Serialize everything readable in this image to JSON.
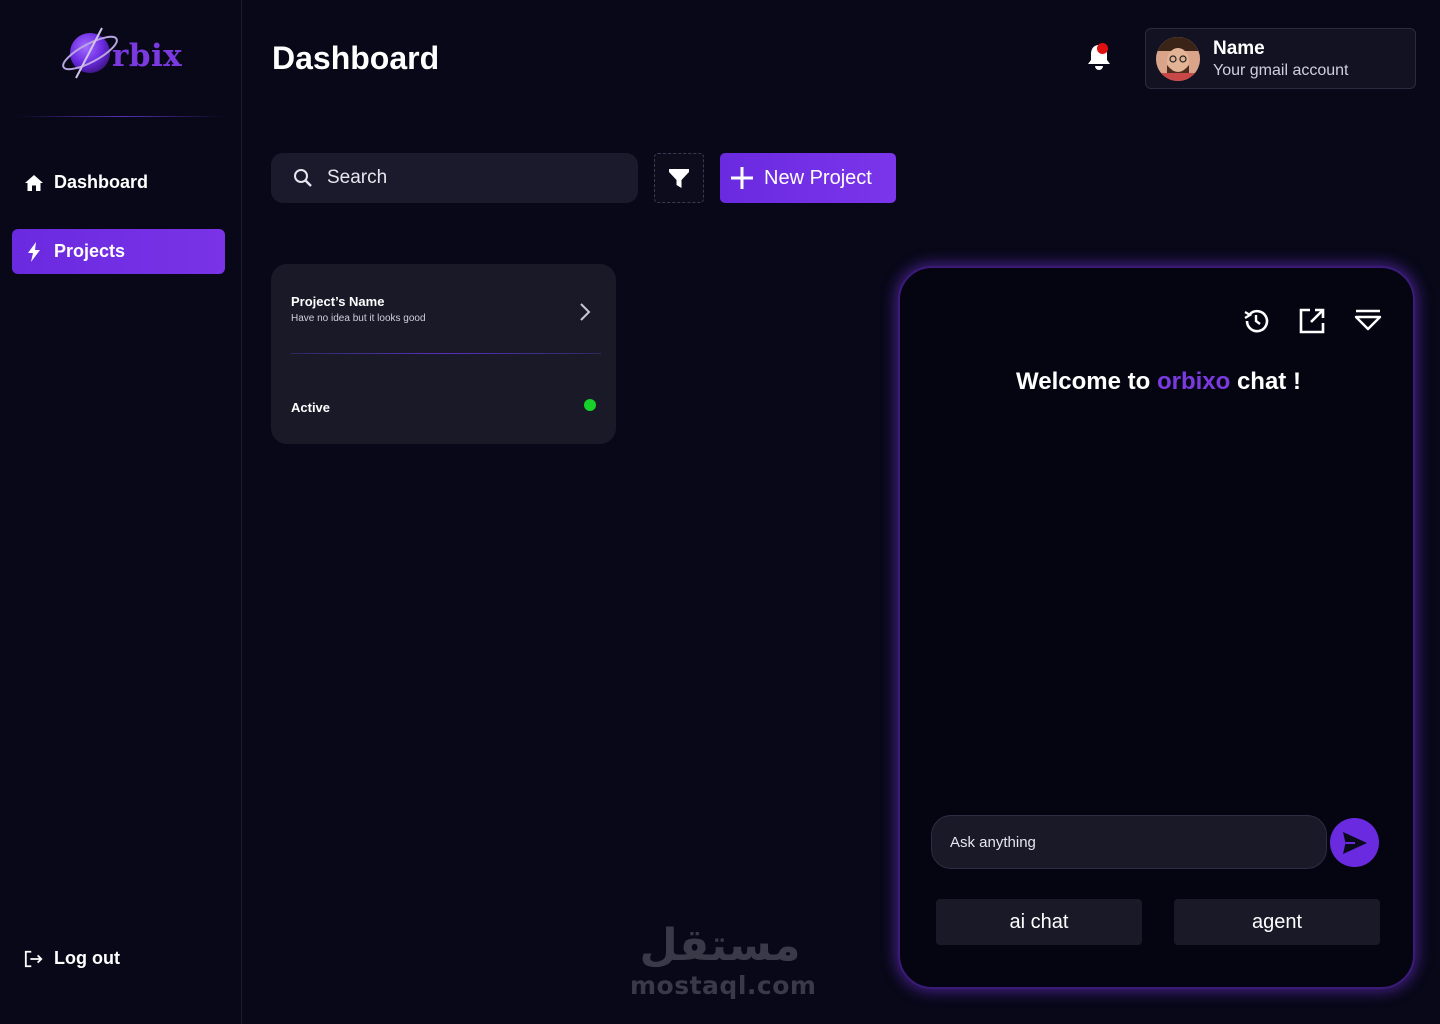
{
  "brand": {
    "logo_text": "rbix",
    "accent_color": "#6a2ae0"
  },
  "sidebar": {
    "items": [
      {
        "label": "Dashboard",
        "icon": "home-icon",
        "active": false
      },
      {
        "label": "Projects",
        "icon": "lightning-icon",
        "active": true
      }
    ],
    "logout_label": "Log out"
  },
  "header": {
    "title": "Dashboard",
    "notification_icon": "bell-icon",
    "has_unread": true,
    "profile": {
      "name": "Name",
      "email": "Your gmail account"
    }
  },
  "toolbar": {
    "search_placeholder": "Search",
    "filter_icon": "filter-icon",
    "new_project_label": "New Project"
  },
  "projects": [
    {
      "name": "Project’s Name",
      "description": "Have no idea but it looks good",
      "status": "Active",
      "status_color": "#17d02a"
    }
  ],
  "chat": {
    "welcome_prefix": "Welcome to",
    "welcome_brand": "orbixo",
    "welcome_suffix": "chat !",
    "input_placeholder": "Ask anything",
    "modes": [
      "ai chat",
      "agent"
    ],
    "icons": [
      "history-icon",
      "open-external-icon",
      "collapse-icon"
    ]
  },
  "watermark": {
    "arabic": "مستقل",
    "latin": "mostaql.com"
  }
}
